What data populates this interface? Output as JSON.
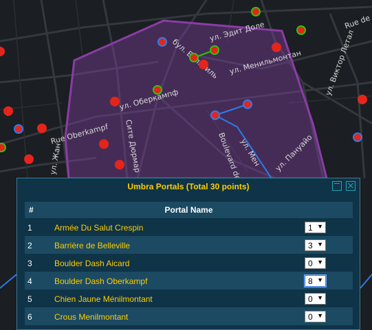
{
  "map": {
    "streets": [
      "ул. Эдит Доле",
      "бул. Бельвиль",
      "ул. Менильмонтан",
      "ул. Оберкампф",
      "Rue Oberkampf",
      "Сите Дюрмар",
      "ул. Мен",
      "Boulevard de",
      "ул. Пануайо",
      "ул. Виктор Летал",
      "Rue de",
      "ул. Жан"
    ]
  },
  "dialog": {
    "title": "Umbra Portals (Total 30 points)",
    "headers": {
      "num": "#",
      "name": "Portal Name"
    },
    "rows": [
      {
        "num": "1",
        "name": "Armée Du Salut Crespin",
        "value": "1"
      },
      {
        "num": "2",
        "name": "Barrière de Belleville",
        "value": "3"
      },
      {
        "num": "3",
        "name": "Boulder Dash Aicard",
        "value": "0"
      },
      {
        "num": "4",
        "name": "Boulder Dash Oberkampf",
        "value": "8"
      },
      {
        "num": "5",
        "name": "Chien Jaune Ménilmontant",
        "value": "0"
      },
      {
        "num": "6",
        "name": "Crous Menilmontant",
        "value": "0"
      }
    ]
  },
  "colors": {
    "portal_red": "#e5251b",
    "portal_green": "#2ec40b",
    "portal_blue": "#2b7de9",
    "area_purple": "#7a3d9a",
    "title_yellow": "#ffce00"
  },
  "icons": {
    "dropdown": "▼"
  }
}
